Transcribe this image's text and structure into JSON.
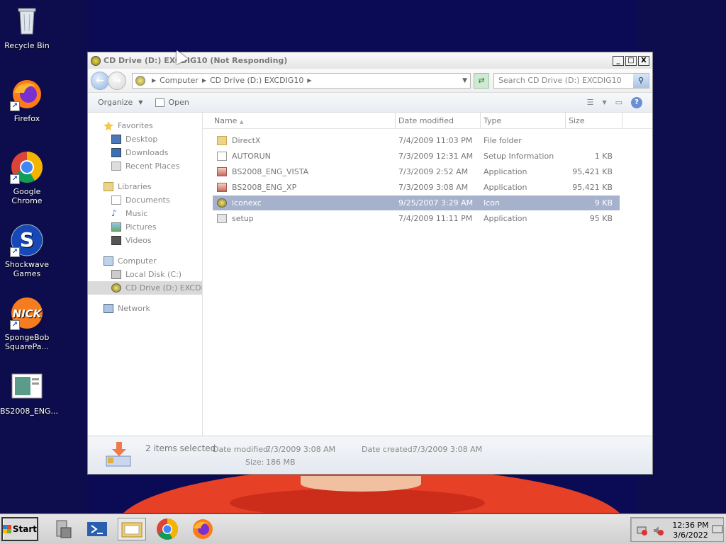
{
  "desktop": {
    "icons": [
      {
        "label": "Recycle Bin"
      },
      {
        "label": "Firefox"
      },
      {
        "label": "Google Chrome"
      },
      {
        "label": "Shockwave Games"
      },
      {
        "label": "SpongeBob SquarePa..."
      },
      {
        "label": "BS2008_ENG..."
      }
    ]
  },
  "window": {
    "title": "CD Drive (D:) EXCDIG10 (Not Responding)",
    "controls": {
      "minimize": "_",
      "maximize": "□",
      "close": "X"
    },
    "breadcrumb": [
      "Computer",
      "CD Drive (D:) EXCDIG10"
    ],
    "search_placeholder": "Search CD Drive (D:) EXCDIG10",
    "toolbar": {
      "organize": "Organize",
      "open": "Open"
    },
    "nav": {
      "favorites": "Favorites",
      "desktop": "Desktop",
      "downloads": "Downloads",
      "recent": "Recent Places",
      "libraries": "Libraries",
      "documents": "Documents",
      "music": "Music",
      "pictures": "Pictures",
      "videos": "Videos",
      "computer": "Computer",
      "local_disk": "Local Disk (C:)",
      "cd_drive": "CD Drive (D:) EXCDIG",
      "network": "Network"
    },
    "columns": {
      "name": "Name",
      "date": "Date modified",
      "type": "Type",
      "size": "Size"
    },
    "files": [
      {
        "name": "DirectX",
        "date": "7/4/2009 11:03 PM",
        "type": "File folder",
        "size": ""
      },
      {
        "name": "AUTORUN",
        "date": "7/3/2009 12:31 AM",
        "type": "Setup Information",
        "size": "1 KB"
      },
      {
        "name": "BS2008_ENG_VISTA",
        "date": "7/3/2009 2:52 AM",
        "type": "Application",
        "size": "95,421 KB"
      },
      {
        "name": "BS2008_ENG_XP",
        "date": "7/3/2009 3:08 AM",
        "type": "Application",
        "size": "95,421 KB"
      },
      {
        "name": "iconexc",
        "date": "9/25/2007 3:29 AM",
        "type": "Icon",
        "size": "9 KB"
      },
      {
        "name": "setup",
        "date": "7/4/2009 11:11 PM",
        "type": "Application",
        "size": "95 KB"
      }
    ],
    "details": {
      "selection": "2 items selected",
      "date_modified_label": "Date modified:",
      "date_modified_value": "7/3/2009 3:08 AM",
      "date_created_label": "Date created:",
      "date_created_value": "7/3/2009 3:08 AM",
      "size_label": "Size:",
      "size_value": "186 MB"
    }
  },
  "taskbar": {
    "start": "Start",
    "time": "12:36 PM",
    "date": "3/6/2022"
  },
  "colors": {
    "selection": "#a6b2cc",
    "desktop_bg": "#0d0d4d"
  }
}
